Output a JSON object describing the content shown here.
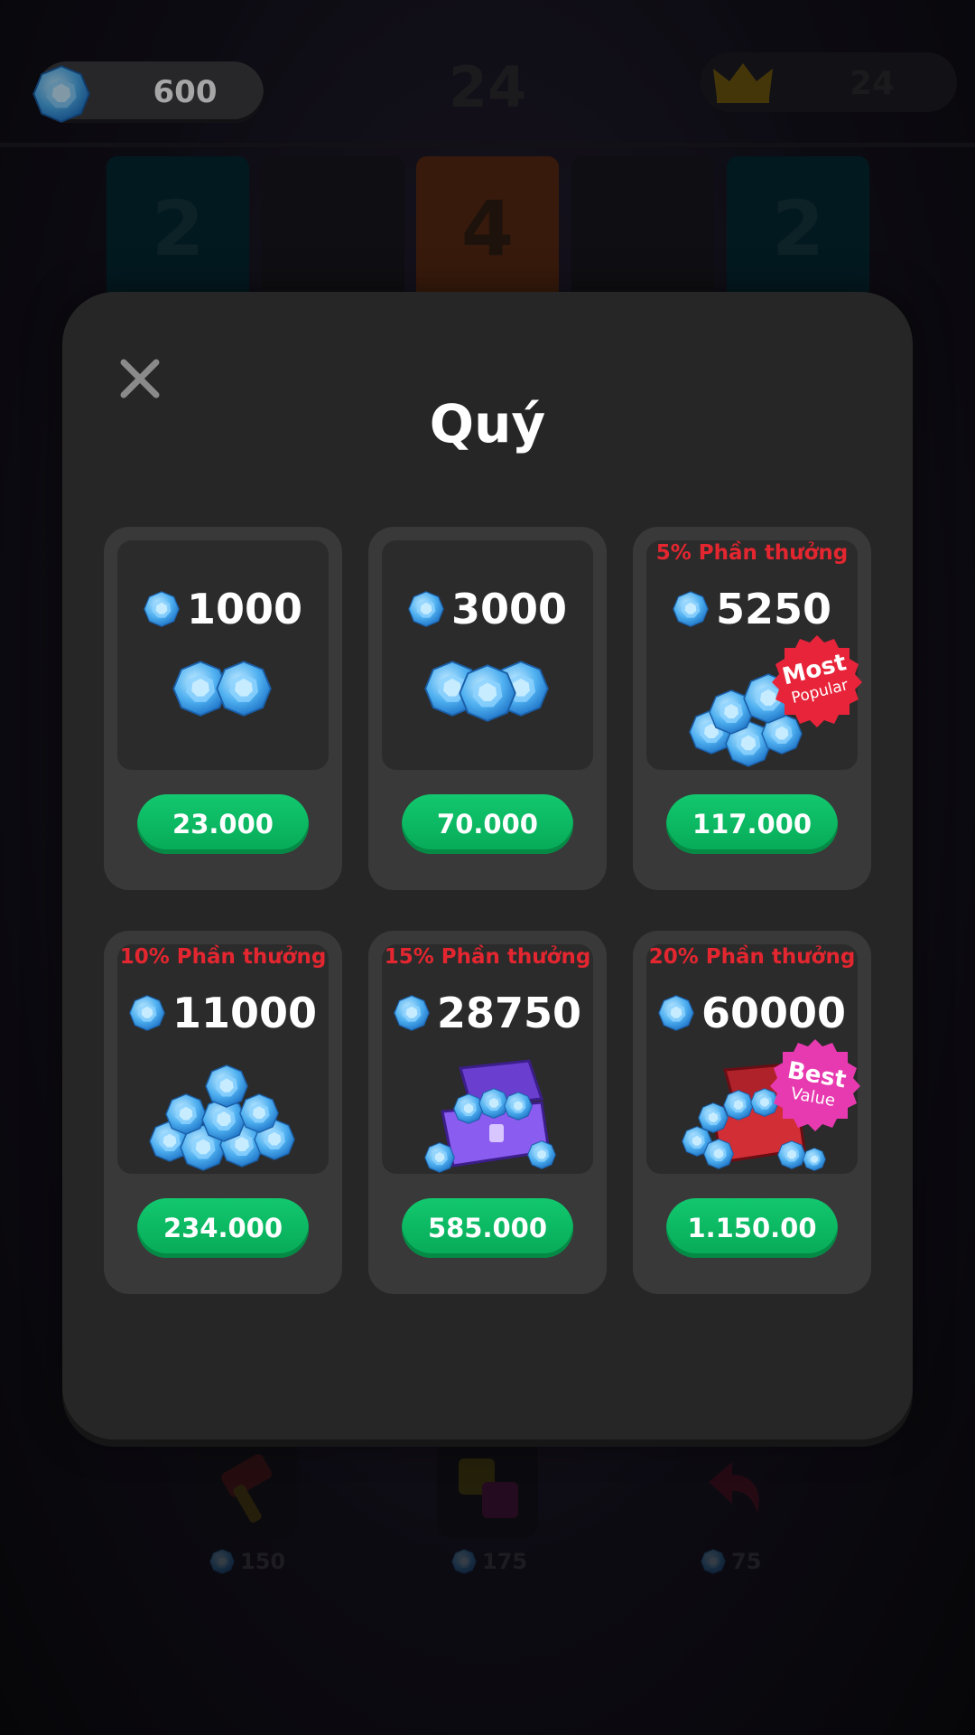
{
  "header": {
    "gems": "600",
    "score": "24",
    "best": "24"
  },
  "board": {
    "tiles": [
      "2",
      "",
      "4",
      "",
      "2"
    ]
  },
  "tools": [
    {
      "name": "hammer",
      "cost": "150"
    },
    {
      "name": "swap",
      "cost": "175"
    },
    {
      "name": "undo",
      "cost": "75"
    }
  ],
  "modal": {
    "title": "Quý",
    "close_icon": "close-icon",
    "packs": [
      {
        "bonus": "",
        "amount": "1000",
        "price": "23.000",
        "art": "two-gems",
        "badge": ""
      },
      {
        "bonus": "",
        "amount": "3000",
        "price": "70.000",
        "art": "three-gems",
        "badge": ""
      },
      {
        "bonus": "5% Phần thưởng",
        "amount": "5250",
        "price": "117.000",
        "art": "gem-pile-small",
        "badge": "most-popular"
      },
      {
        "bonus": "10% Phần thưởng",
        "amount": "11000",
        "price": "234.000",
        "art": "gem-pile-large",
        "badge": ""
      },
      {
        "bonus": "15% Phần thưởng",
        "amount": "28750",
        "price": "585.000",
        "art": "purple-chest",
        "badge": ""
      },
      {
        "bonus": "20% Phần thưởng",
        "amount": "60000",
        "price": "1.150.00",
        "art": "red-chest",
        "badge": "best-value"
      }
    ],
    "badges": {
      "most_popular": {
        "line1": "Most",
        "line2": "Popular",
        "color": "#e8243a"
      },
      "best_value": {
        "line1": "Best",
        "line2": "Value",
        "color": "#e83ab0"
      }
    }
  },
  "colors": {
    "buy_button": "#0fbe66",
    "bonus_text": "#e3262f",
    "modal_bg": "#262626",
    "card_bg": "#393939"
  }
}
